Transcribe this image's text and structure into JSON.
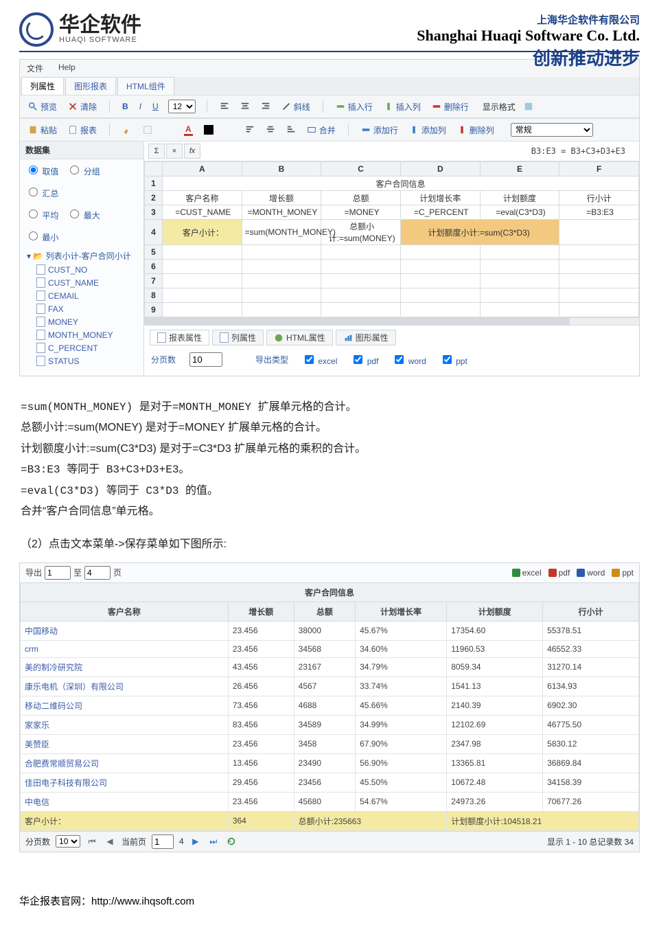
{
  "header": {
    "company_cn": "上海华企软件有限公司",
    "company_en": "Shanghai Huaqi Software Co. Ltd.",
    "slogan": "创新推动进步",
    "logo_cn": "华企软件",
    "logo_en": "HUAQI SOFTWARE"
  },
  "editor": {
    "menubar": [
      "文件",
      "Help"
    ],
    "tabs": [
      "列属性",
      "图形报表",
      "HTML组件"
    ],
    "toolbar": {
      "preview": "预览",
      "clear": "清除",
      "paste": "粘贴",
      "report": "报表",
      "bold": "B",
      "italic": "I",
      "underline": "U",
      "font_size": "12",
      "slant": "斜线",
      "merge": "合并",
      "insert_row": "插入行",
      "insert_col": "插入列",
      "delete_row": "删除行",
      "add_row": "添加行",
      "add_col": "添加列",
      "delete_col": "删除列",
      "format_label": "显示格式",
      "format_value": "常规"
    },
    "side": {
      "title": "数据集",
      "radios1": [
        "取值",
        "分组",
        "汇总"
      ],
      "radios2": [
        "平均",
        "最大",
        "最小"
      ],
      "tree_root": "列表小计-客户合同小计",
      "fields": [
        "CUST_NO",
        "CUST_NAME",
        "CEMAIL",
        "FAX",
        "MONEY",
        "MONTH_MONEY",
        "C_PERCENT",
        "STATUS"
      ]
    },
    "formula_bar": {
      "sigma": "Σ",
      "x": "×",
      "fx": "fx",
      "message": "B3:E3 = B3+C3+D3+E3"
    },
    "grid": {
      "cols": [
        "A",
        "B",
        "C",
        "D",
        "E",
        "F"
      ],
      "row1_title": "客户合同信息",
      "row2": [
        "客户名称",
        "增长额",
        "总额",
        "计划增长率",
        "计划额度",
        "行小计"
      ],
      "row3": [
        "=CUST_NAME",
        "=MONTH_MONEY",
        "=MONEY",
        "=C_PERCENT",
        "=eval(C3*D3)",
        "=B3:E3"
      ],
      "row4": {
        "a": "客户小计：",
        "b": "=sum(MONTH_MONEY)",
        "c": "总额小计:=sum(MONEY)",
        "de": "计划额度小计:=sum(C3*D3)"
      }
    },
    "prop_tabs": [
      "报表属性",
      "列属性",
      "HTML属性",
      "图形属性"
    ],
    "props": {
      "page_label": "分页数",
      "page_val": "10",
      "export_label": "导出类型",
      "exports": [
        "excel",
        "pdf",
        "word",
        "ppt"
      ]
    }
  },
  "explain": {
    "lines": [
      "=sum(MONTH_MONEY) 是对于=MONTH_MONEY 扩展单元格的合计。",
      "总额小计:=sum(MONEY) 是对于=MONEY 扩展单元格的合计。",
      "计划额度小计:=sum(C3*D3)  是对于=C3*D3 扩展单元格的乘积的合计。",
      "=B3:E3  等同于 B3+C3+D3+E3。",
      "=eval(C3*D3)  等同于 C3*D3 的值。",
      "合并“客户合同信息”单元格。"
    ],
    "step": "（2）点击文本菜单->保存菜单如下图所示:"
  },
  "result": {
    "export_lbl": "导出",
    "from": "1",
    "to_lbl": "至",
    "to": "4",
    "page_word": "页",
    "chips": [
      "excel",
      "pdf",
      "word",
      "ppt"
    ],
    "chip_colors": [
      "#2e8b3d",
      "#c0392b",
      "#2e5aac",
      "#d08a1a"
    ],
    "title": "客户合同信息",
    "columns": [
      "客户名称",
      "增长额",
      "总额",
      "计划增长率",
      "计划额度",
      "行小计"
    ],
    "rows": [
      [
        "中国移动",
        "23.456",
        "38000",
        "45.67%",
        "17354.60",
        "55378.51"
      ],
      [
        "crm",
        "23.456",
        "34568",
        "34.60%",
        "11960.53",
        "46552.33"
      ],
      [
        "美的制冷研究院",
        "43.456",
        "23167",
        "34.79%",
        "8059.34",
        "31270.14"
      ],
      [
        "康乐电机（深圳）有限公司",
        "26.456",
        "4567",
        "33.74%",
        "1541.13",
        "6134.93"
      ],
      [
        "移动二维码公司",
        "73.456",
        "4688",
        "45.66%",
        "2140.39",
        "6902.30"
      ],
      [
        "家家乐",
        "83.456",
        "34589",
        "34.99%",
        "12102.69",
        "46775.50"
      ],
      [
        "美赞臣",
        "23.456",
        "3458",
        "67.90%",
        "2347.98",
        "5830.12"
      ],
      [
        "合肥费常顺贸易公司",
        "13.456",
        "23490",
        "56.90%",
        "13365.81",
        "36869.84"
      ],
      [
        "佳田电子科技有限公司",
        "29.456",
        "23456",
        "45.50%",
        "10672.48",
        "34158.39"
      ],
      [
        "中电信",
        "23.456",
        "45680",
        "54.67%",
        "24973.26",
        "70677.26"
      ]
    ],
    "subtotal": {
      "label": "客户小计：",
      "growth": "364",
      "total_label": "总额小计:235663",
      "plan_label": "计划额度小计:104518.21"
    },
    "footer": {
      "page_size_lbl": "分页数",
      "page_size": "10",
      "cur_page_lbl": "当前页",
      "cur_page": "1",
      "total_pages": "4",
      "summary": "显示 1 - 10 总记录数 34"
    }
  },
  "footer_link": "华企报表官网：http://www.ihqsoft.com",
  "chart_data": {
    "type": "table",
    "title": "客户合同信息",
    "columns": [
      "客户名称",
      "增长额",
      "总额",
      "计划增长率",
      "计划额度",
      "行小计"
    ],
    "rows": [
      [
        "中国移动",
        23.456,
        38000,
        0.4567,
        17354.6,
        55378.51
      ],
      [
        "crm",
        23.456,
        34568,
        0.346,
        11960.53,
        46552.33
      ],
      [
        "美的制冷研究院",
        43.456,
        23167,
        0.3479,
        8059.34,
        31270.14
      ],
      [
        "康乐电机（深圳）有限公司",
        26.456,
        4567,
        0.3374,
        1541.13,
        6134.93
      ],
      [
        "移动二维码公司",
        73.456,
        4688,
        0.4566,
        2140.39,
        6902.3
      ],
      [
        "家家乐",
        83.456,
        34589,
        0.3499,
        12102.69,
        46775.5
      ],
      [
        "美赞臣",
        23.456,
        3458,
        0.679,
        2347.98,
        5830.12
      ],
      [
        "合肥费常顺贸易公司",
        13.456,
        23490,
        0.569,
        13365.81,
        36869.84
      ],
      [
        "佳田电子科技有限公司",
        29.456,
        23456,
        0.455,
        10672.48,
        34158.39
      ],
      [
        "中电信",
        23.456,
        45680,
        0.5467,
        24973.26,
        70677.26
      ]
    ],
    "subtotal": {
      "增长额": 364,
      "总额": 235663,
      "计划额度": 104518.21
    }
  }
}
